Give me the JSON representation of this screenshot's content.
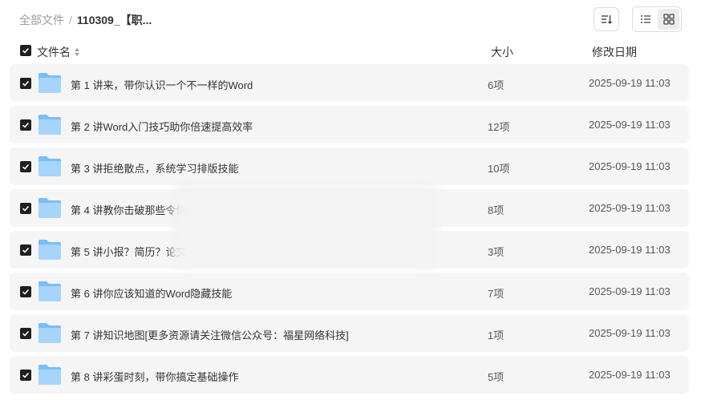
{
  "breadcrumb": {
    "root": "全部文件",
    "separator": "/",
    "current": "110309_【职..."
  },
  "toolbar": {
    "sort_icon": "sort-icon",
    "view_list_icon": "list-view-icon",
    "view_grid_icon": "grid-view-icon",
    "active_view": "grid"
  },
  "columns": {
    "name": "文件名",
    "size": "大小",
    "modified": "修改日期"
  },
  "colors": {
    "row_bg": "#f5f5f5",
    "checkbox": "#1f1f1f",
    "folder_light": "#a6d4fb",
    "folder_dark": "#7bbdf6"
  },
  "files": [
    {
      "name": "第 1 讲来，带你认识一个不一样的Word",
      "size": "6项",
      "modified": "2025-09-19 11:03",
      "checked": true
    },
    {
      "name": "第 2 讲Word入门技巧助你倍速提高效率",
      "size": "12项",
      "modified": "2025-09-19 11:03",
      "checked": true
    },
    {
      "name": "第 3 讲拒绝散点，系统学习排版技能",
      "size": "10项",
      "modified": "2025-09-19 11:03",
      "checked": true
    },
    {
      "name": "第 4 讲教你击破那些令你",
      "size": "8项",
      "modified": "2025-09-19 11:03",
      "checked": true
    },
    {
      "name": "第 5 讲小报？简历？论文",
      "size": "3项",
      "modified": "2025-09-19 11:03",
      "checked": true
    },
    {
      "name": "第 6 讲你应该知道的Word隐藏技能",
      "size": "7项",
      "modified": "2025-09-19 11:03",
      "checked": true
    },
    {
      "name": "第 7 讲知识地图[更多资源请关注微信公众号：福星网络科技]",
      "size": "1项",
      "modified": "2025-09-19 11:03",
      "checked": true
    },
    {
      "name": "第 8 讲彩蛋时刻，带你搞定基础操作",
      "size": "5项",
      "modified": "2025-09-19 11:03",
      "checked": true
    }
  ]
}
